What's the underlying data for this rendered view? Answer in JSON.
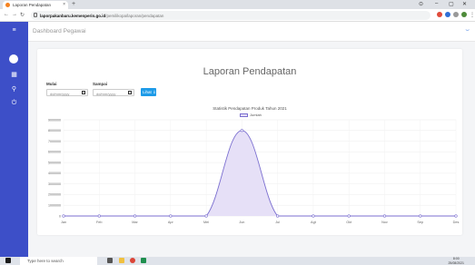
{
  "browser": {
    "tab_title": "Laporan Pendapatan",
    "close": "×",
    "new_tab": "+",
    "win_controls": [
      "⊙",
      "–",
      "▢",
      "✕"
    ],
    "url_host": "laporpakanbaru.kemenperin.go.id",
    "url_path": "/pemilikopa/laporan/pendapatan"
  },
  "header": {
    "title": "Dashboard Pegawai"
  },
  "report": {
    "title": "Laporan Pendapatan",
    "from_label": "Mulai",
    "to_label": "Sampai",
    "date_placeholder": "dd/mm/yyyy",
    "submit_label": "Lihat ⇓"
  },
  "chart_data": {
    "type": "area",
    "title": "Statistik Pendapatan Produk Tahun 2021",
    "legend": [
      "Jumlah"
    ],
    "categories": [
      "Jan",
      "Feb",
      "Mar",
      "Apr",
      "Mei",
      "Jun",
      "Jul",
      "Agt",
      "Okt",
      "Nov",
      "Sep",
      "Des"
    ],
    "series": [
      {
        "name": "Jumlah",
        "values": [
          0,
          0,
          0,
          0,
          0,
          8000000,
          0,
          0,
          0,
          0,
          0,
          0
        ]
      }
    ],
    "ylim": [
      0,
      9000000
    ],
    "yticks": [
      "9000000",
      "8000000",
      "7000000",
      "6000000",
      "5000000",
      "4000000",
      "3000000",
      "2000000",
      "1000000",
      "0"
    ],
    "grid": true,
    "legend_position": "top-center",
    "colors": {
      "line": "#7b6fd0",
      "fill": "#e6e0f7"
    }
  },
  "taskbar": {
    "search_placeholder": "Type here to search",
    "time": "8:00",
    "date": "25/08/2021"
  }
}
